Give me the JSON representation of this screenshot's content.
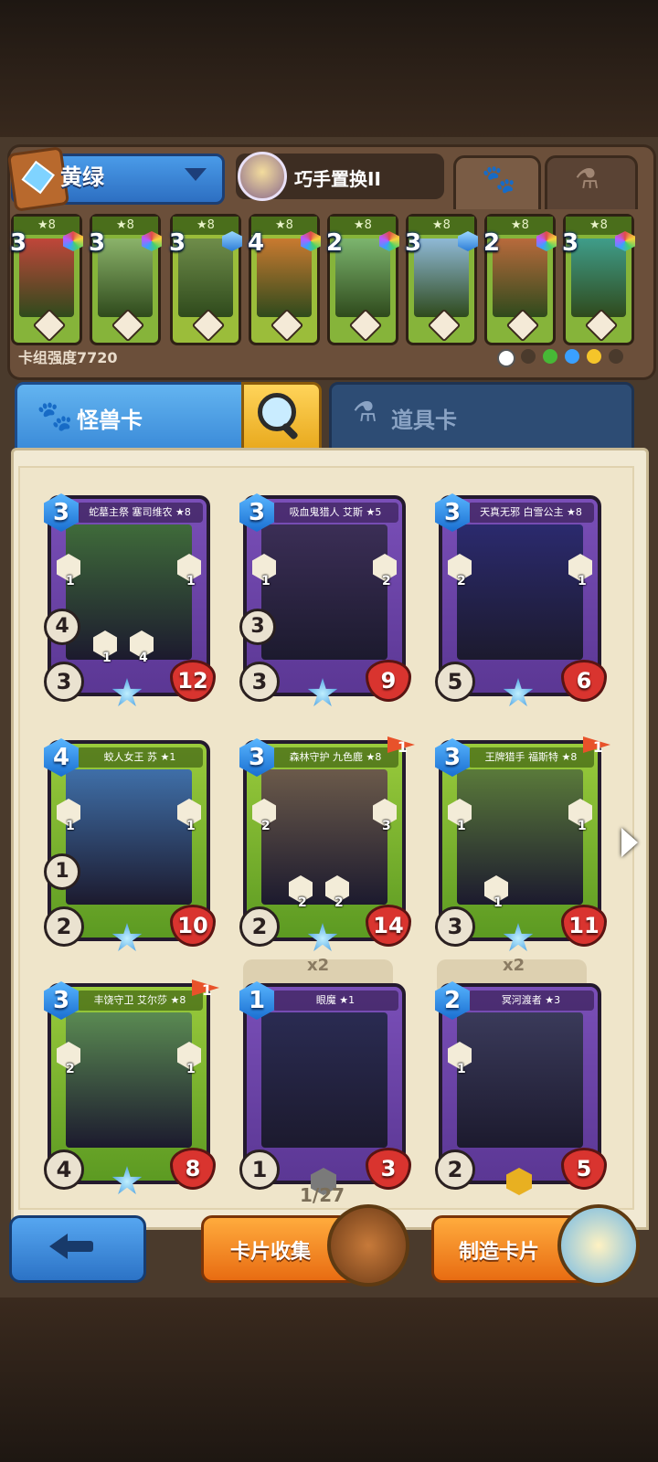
{
  "deck": {
    "name": "黄绿",
    "hero_name": "巧手置换II",
    "power_label": "卡组强度7720",
    "slots": [
      {
        "stars": "★8",
        "cost": "3",
        "art_color": "#c0463a"
      },
      {
        "stars": "★8",
        "cost": "3",
        "art_color": "#8bb36a"
      },
      {
        "stars": "★8",
        "cost": "3",
        "art_color": "#6f8d4a"
      },
      {
        "stars": "★8",
        "cost": "4",
        "art_color": "#c97a30"
      },
      {
        "stars": "★8",
        "cost": "2",
        "art_color": "#7cb56e"
      },
      {
        "stars": "★8",
        "cost": "3",
        "art_color": "#8fb9d6"
      },
      {
        "stars": "★8",
        "cost": "2",
        "art_color": "#b86a3c"
      },
      {
        "stars": "★8",
        "cost": "3",
        "art_color": "#3f9d8a"
      }
    ]
  },
  "tabs": {
    "monster": "怪兽卡",
    "item": "道具卡"
  },
  "cards": [
    {
      "title": "蛇墓主祭 塞司维农 ★8",
      "cost": "3",
      "speed": "4",
      "attack": "3",
      "hp": "12",
      "skills": [
        "1",
        "1",
        "1",
        "4"
      ]
    },
    {
      "title": "吸血鬼猎人 艾斯 ★5",
      "cost": "3",
      "speed": "3",
      "attack": "3",
      "hp": "9",
      "skills": [
        "1",
        "2"
      ]
    },
    {
      "title": "天真无邪 白雪公主 ★8",
      "cost": "3",
      "speed": "",
      "attack": "5",
      "hp": "6",
      "skills": [
        "2",
        "1"
      ]
    },
    {
      "title": "蛟人女王 苏 ★1",
      "cost": "4",
      "speed": "1",
      "attack": "2",
      "hp": "10",
      "skills": [
        "1",
        "1"
      ]
    },
    {
      "title": "森林守护 九色鹿 ★8",
      "cost": "3",
      "speed": "",
      "attack": "2",
      "hp": "14",
      "flag": "1",
      "skills": [
        "2",
        "3",
        "2",
        "2"
      ]
    },
    {
      "title": "王牌猎手 福斯特 ★8",
      "cost": "3",
      "speed": "",
      "attack": "3",
      "hp": "11",
      "flag": "1",
      "skills": [
        "1",
        "1",
        "1"
      ]
    },
    {
      "title": "丰饶守卫 艾尔莎 ★8",
      "cost": "3",
      "speed": "",
      "attack": "4",
      "hp": "8",
      "flag": "1",
      "skills": [
        "2",
        "1"
      ]
    },
    {
      "title": "眼魔 ★1",
      "cost": "1",
      "speed": "",
      "attack": "1",
      "hp": "3",
      "multi": "x2",
      "skills": []
    },
    {
      "title": "冥河渡者 ★3",
      "cost": "2",
      "speed": "",
      "attack": "2",
      "hp": "5",
      "multi": "x2",
      "skills": [
        "1"
      ]
    }
  ],
  "pager": "1/27",
  "buttons": {
    "collection": "卡片收集",
    "craft": "制造卡片"
  }
}
